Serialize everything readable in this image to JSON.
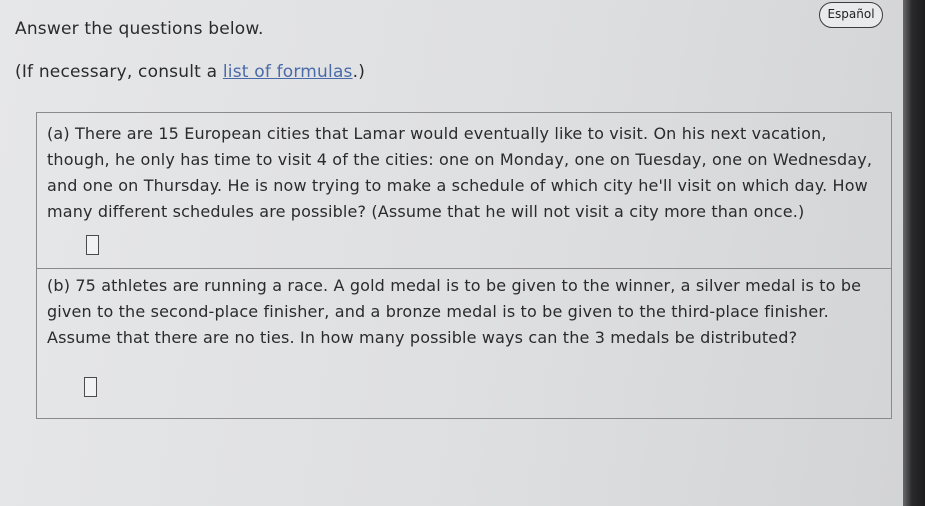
{
  "header": {
    "language_button": "Español",
    "instructions": "Answer the questions below.",
    "consult_prefix": "(If necessary, consult a ",
    "consult_link": "list of formulas",
    "consult_suffix": ".)"
  },
  "questions": [
    {
      "label": "(a)",
      "text": "(a) There are 15 European cities that Lamar would eventually like to visit. On his next vacation, though, he only has time to visit 4 of the cities: one on Monday, one on Tuesday, one on Wednesday, and one on Thursday. He is now trying to make a schedule of which city he'll visit on which day. How many different schedules are possible? (Assume that he will not visit a city more than once.)",
      "answer": ""
    },
    {
      "label": "(b)",
      "text": "(b) 75 athletes are running a race. A gold medal is to be given to the winner, a silver medal is to be given to the second-place finisher, and a bronze medal is to be given to the third-place finisher. Assume that there are no ties. In how many possible ways can the 3 medals be distributed?",
      "answer": ""
    }
  ]
}
